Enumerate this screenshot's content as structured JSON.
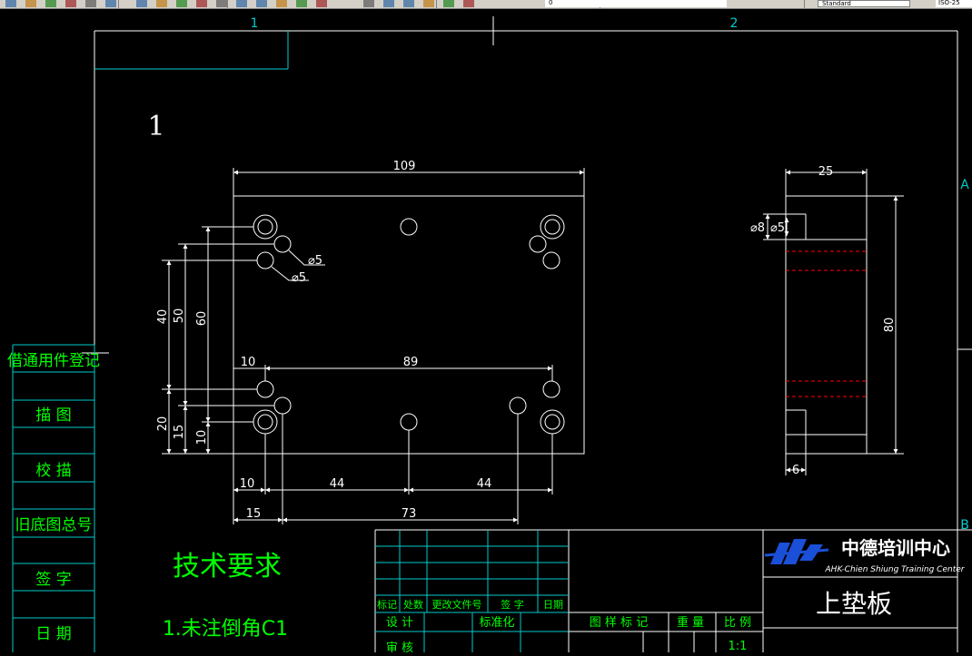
{
  "toolbar": {
    "icons": [
      "new-icon",
      "open-icon",
      "save-icon",
      "print-icon",
      "cut-icon",
      "undo-icon",
      "pan-icon",
      "zoom-icon",
      "zoom-window-icon",
      "zoom-previous-icon",
      "properties-icon",
      "design-center-icon",
      "tool-palettes-icon",
      "markup-icon",
      "calculator-icon",
      "help-icon",
      "layers-icon",
      "layer-state-icon",
      "sun-icon",
      "lock-icon",
      "text-style-icon",
      "dim-style-icon"
    ],
    "layer_value": "0",
    "text_style": "Standard",
    "right_field": "ISO-25"
  },
  "border": {
    "col1": "1",
    "col2": "2",
    "rowA": "A",
    "rowB": "B"
  },
  "view_number": "1",
  "front_view_dims": {
    "width": "109",
    "hole_span": "89",
    "d_small1": "⌀5",
    "d_small2": "⌀5",
    "v40": "40",
    "v50": "50",
    "v60": "60",
    "v20": "20",
    "v15": "15",
    "v10": "10",
    "top10": "10",
    "b10": "10",
    "b44a": "44",
    "b44b": "44",
    "b15": "15",
    "b73": "73"
  },
  "side_view_dims": {
    "thickness": "25",
    "height": "80",
    "bottom": "6",
    "d8": "⌀8",
    "d5": "⌀5"
  },
  "left_strip": {
    "r1": "借通用件登记",
    "r2": "描   图",
    "r3": "校   描",
    "r4": "旧底图总号",
    "r5": "签   字",
    "r6": "日   期"
  },
  "tech": {
    "title": "技术要求",
    "item1": "1.未注倒角C1"
  },
  "title_block": {
    "h1": "标记",
    "h2": "处数",
    "h3": "更改文件号",
    "h4": "签 字",
    "h5": "日期",
    "design": "设 计",
    "standard": "标准化",
    "review": "审 核",
    "stage_mark": "图 样 标 记",
    "weight": "重 量",
    "scale": "比 例",
    "scale_val": "1:1",
    "company": "中德培训中心",
    "company_en": "AHK-Chien Shiung Training Center",
    "part_name": "上垫板"
  },
  "colors": {
    "toolbar": "#d4d0c8",
    "frame": "#ffffff",
    "cyan": "#00cccc",
    "green": "#00ff00",
    "red": "#ff0000",
    "blue": "#1a4fd8"
  }
}
